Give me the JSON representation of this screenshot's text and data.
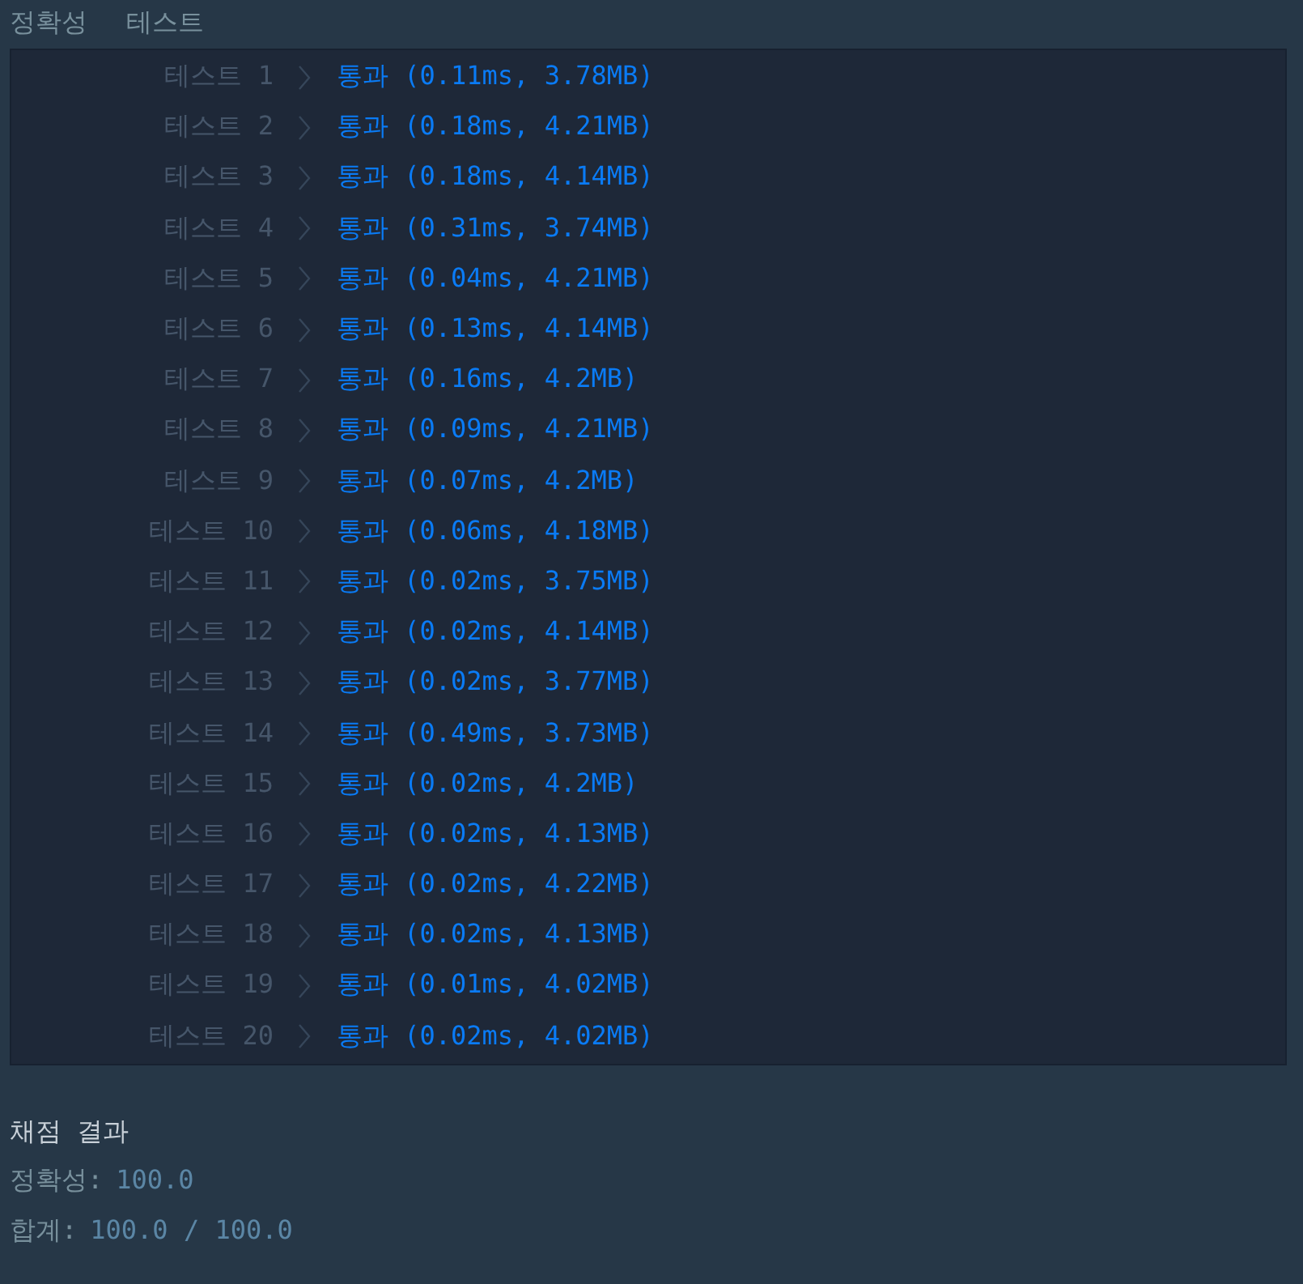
{
  "header": {
    "columns": [
      "정확성",
      "테스트"
    ]
  },
  "tests": [
    {
      "label": "테스트 1",
      "result": "통과 (0.11ms, 3.78MB)"
    },
    {
      "label": "테스트 2",
      "result": "통과 (0.18ms, 4.21MB)"
    },
    {
      "label": "테스트 3",
      "result": "통과 (0.18ms, 4.14MB)"
    },
    {
      "label": "테스트 4",
      "result": "통과 (0.31ms, 3.74MB)"
    },
    {
      "label": "테스트 5",
      "result": "통과 (0.04ms, 4.21MB)"
    },
    {
      "label": "테스트 6",
      "result": "통과 (0.13ms, 4.14MB)"
    },
    {
      "label": "테스트 7",
      "result": "통과 (0.16ms, 4.2MB)"
    },
    {
      "label": "테스트 8",
      "result": "통과 (0.09ms, 4.21MB)"
    },
    {
      "label": "테스트 9",
      "result": "통과 (0.07ms, 4.2MB)"
    },
    {
      "label": "테스트 10",
      "result": "통과 (0.06ms, 4.18MB)"
    },
    {
      "label": "테스트 11",
      "result": "통과 (0.02ms, 3.75MB)"
    },
    {
      "label": "테스트 12",
      "result": "통과 (0.02ms, 4.14MB)"
    },
    {
      "label": "테스트 13",
      "result": "통과 (0.02ms, 3.77MB)"
    },
    {
      "label": "테스트 14",
      "result": "통과 (0.49ms, 3.73MB)"
    },
    {
      "label": "테스트 15",
      "result": "통과 (0.02ms, 4.2MB)"
    },
    {
      "label": "테스트 16",
      "result": "통과 (0.02ms, 4.13MB)"
    },
    {
      "label": "테스트 17",
      "result": "통과 (0.02ms, 4.22MB)"
    },
    {
      "label": "테스트 18",
      "result": "통과 (0.02ms, 4.13MB)"
    },
    {
      "label": "테스트 19",
      "result": "통과 (0.01ms, 4.02MB)"
    },
    {
      "label": "테스트 20",
      "result": "통과 (0.02ms, 4.02MB)"
    }
  ],
  "summary": {
    "title": "채점 결과",
    "lines": [
      {
        "label": "정확성:",
        "value": "100.0"
      },
      {
        "label": "합계:",
        "value": "100.0 / 100.0"
      }
    ]
  }
}
